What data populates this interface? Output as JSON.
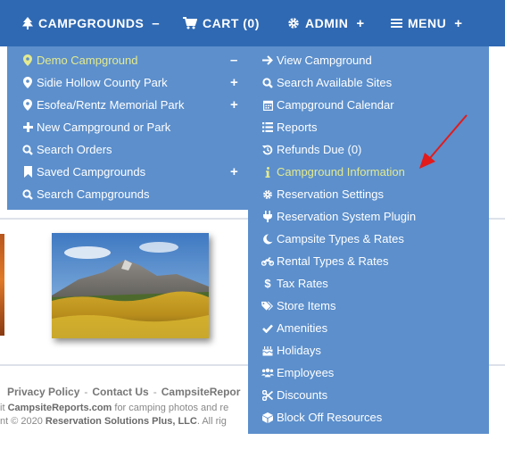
{
  "nav": {
    "campgrounds": {
      "label": "CAMPGROUNDS",
      "toggle": "–"
    },
    "cart": {
      "label": "CART (0)"
    },
    "admin": {
      "label": "ADMIN",
      "toggle": "+"
    },
    "menu": {
      "label": "MENU",
      "toggle": "+"
    }
  },
  "campgrounds_menu": {
    "items": [
      {
        "label": "Demo Campground",
        "icon": "map-marker-icon",
        "toggle": "–",
        "active": true
      },
      {
        "label": "Sidie Hollow County Park",
        "icon": "map-marker-icon",
        "toggle": "+"
      },
      {
        "label": "Esofea/Rentz Memorial Park",
        "icon": "map-marker-icon",
        "toggle": "+"
      },
      {
        "label": "New Campground or Park",
        "icon": "plus-icon"
      },
      {
        "label": "Search Orders",
        "icon": "search-icon"
      },
      {
        "label": "Saved Campgrounds",
        "icon": "bookmark-icon",
        "toggle": "+"
      },
      {
        "label": "Search Campgrounds",
        "icon": "search-icon"
      }
    ]
  },
  "campground_submenu": {
    "items": [
      {
        "label": "View Campground",
        "icon": "arrow-right-icon"
      },
      {
        "label": "Search Available Sites",
        "icon": "search-icon"
      },
      {
        "label": "Campground Calendar",
        "icon": "calendar-icon"
      },
      {
        "label": "Reports",
        "icon": "list-icon"
      },
      {
        "label": "Refunds Due (0)",
        "icon": "history-icon"
      },
      {
        "label": "Campground Information",
        "icon": "info-icon",
        "active": true
      },
      {
        "label": "Reservation Settings",
        "icon": "gear-icon"
      },
      {
        "label": "Reservation System Plugin",
        "icon": "plug-icon"
      },
      {
        "label": "Campsite Types & Rates",
        "icon": "moon-icon"
      },
      {
        "label": "Rental Types & Rates",
        "icon": "motorcycle-icon"
      },
      {
        "label": "Tax Rates",
        "icon": "dollar-icon"
      },
      {
        "label": "Store Items",
        "icon": "tags-icon"
      },
      {
        "label": "Amenities",
        "icon": "check-icon"
      },
      {
        "label": "Holidays",
        "icon": "cake-icon"
      },
      {
        "label": "Employees",
        "icon": "users-icon"
      },
      {
        "label": "Discounts",
        "icon": "scissors-icon"
      },
      {
        "label": "Block Off Resources",
        "icon": "cube-icon"
      }
    ]
  },
  "footer": {
    "privacy": "Privacy Policy",
    "contact": "Contact Us",
    "campsite_reports": "CampsiteRepor",
    "sep": "-",
    "line2_pre": "it ",
    "line2_site": "CampsiteReports.com",
    "line2_post": " for camping photos and re",
    "line3_pre": "nt © 2020 ",
    "line3_company": "Reservation Solutions Plus, LLC",
    "line3_post": ". All rig"
  },
  "colors": {
    "navbar": "#2f69b3",
    "dropdown": "#5c8fcc",
    "active_item": "#e3ea8f",
    "annotation_arrow": "#e31b1b"
  }
}
